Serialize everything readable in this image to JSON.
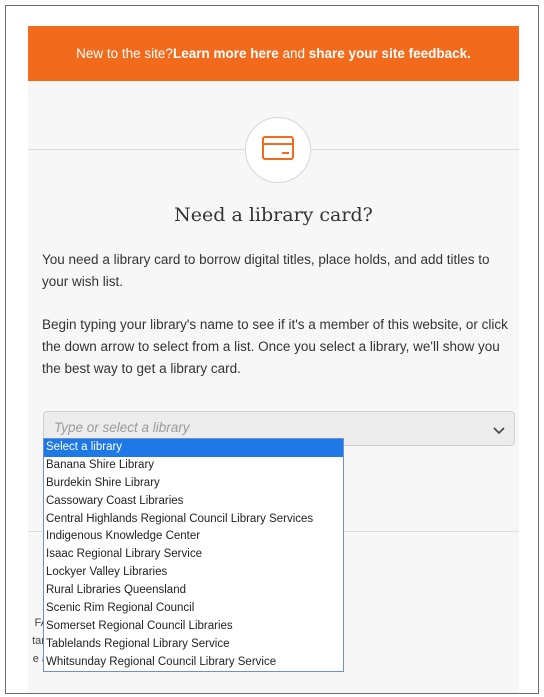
{
  "banner": {
    "prefix": "New to the site? ",
    "learn_link": "Learn more here",
    "middle": " and ",
    "feedback_link": "share your site feedback."
  },
  "heading": "Need a library card?",
  "paragraph1": "You need a library card to borrow digital titles, place holds, and add titles to your wish list.",
  "paragraph2": "Begin typing your library's name to see if it's a member of this website, or click the down arrow to select from a list. Once you select a library, we'll show you the best way to get a library card.",
  "library_select": {
    "placeholder": "Type or select a library",
    "options": [
      "Select a library",
      "Banana Shire Library",
      "Burdekin Shire Library",
      "Cassowary Coast Libraries",
      "Central Highlands Regional Council Library Services",
      "Indigenous Knowledge Center",
      "Isaac Regional Library Service",
      "Lockyer Valley Libraries",
      "Rural Libraries Queensland",
      "Scenic Rim Regional Council",
      "Somerset Regional Council Libraries",
      "Tablelands Regional Library Service",
      "Whitsunday Regional Council Library Service"
    ],
    "selected_index": 0
  },
  "obscured_text": [
    "FA",
    "tart",
    "e a"
  ],
  "colors": {
    "accent": "#f26b1d",
    "selection": "#1e78e6"
  },
  "icons": {
    "card": "credit-card-icon",
    "dropdown": "chevron-down-icon"
  }
}
